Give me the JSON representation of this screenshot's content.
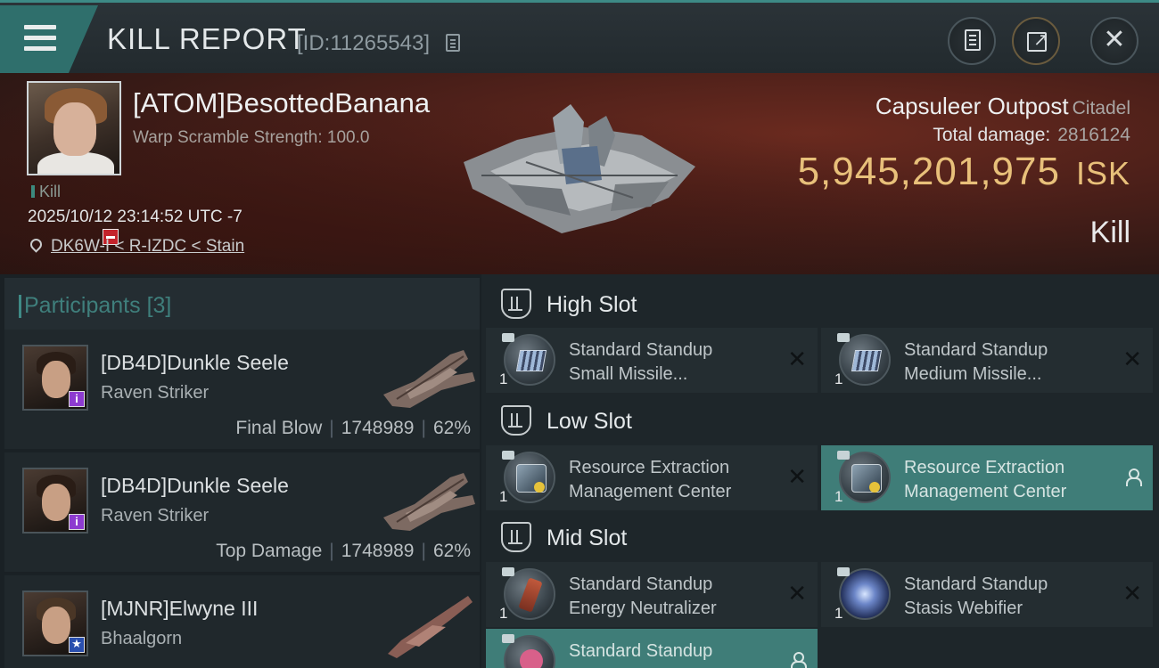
{
  "header": {
    "title": "KILL REPORT",
    "report_id": "[ID:11265543]",
    "icons": {
      "menu": "hamburger-menu-icon",
      "copy": "copy-icon",
      "notes": "clipboard-icon",
      "share": "share-icon",
      "close": "close-icon"
    },
    "accent_color": "#2f6f6c"
  },
  "victim": {
    "name": "[ATOM]BesottedBanana",
    "warp_scramble": "Warp Scramble Strength: 100.0",
    "kill_tag": "Kill",
    "datetime": "2025/10/12 23:14:52 UTC -7",
    "location": "DK6W-I < R-IZDC < Stain",
    "target_name": "Capsuleer Outpost",
    "target_type": "Citadel",
    "total_damage_label": "Total damage:",
    "total_damage_value": "2816124",
    "isk_value": "5,945,201,975",
    "isk_unit": "ISK",
    "result_label": "Kill",
    "isk_color": "#e8c07a"
  },
  "participants": {
    "title": "Participants",
    "count": "[3]",
    "rows": [
      {
        "name": "[DB4D]Dunkle Seele",
        "ship": "Raven Striker",
        "role": "Final Blow",
        "damage": "1748989",
        "percent": "62%",
        "badge": "purple-info-badge"
      },
      {
        "name": "[DB4D]Dunkle Seele",
        "ship": "Raven Striker",
        "role": "Top Damage",
        "damage": "1748989",
        "percent": "62%",
        "badge": "purple-info-badge"
      },
      {
        "name": "[MJNR]Elwyne III",
        "ship": "Bhaalgorn",
        "badge": "blue-star-badge"
      }
    ]
  },
  "slots": {
    "high": {
      "label": "High Slot",
      "modules": [
        {
          "line1": "Standard Standup",
          "line2": "Small Missile...",
          "qty": "1",
          "state": "destroyed"
        },
        {
          "line1": "Standard Standup",
          "line2": "Medium Missile...",
          "qty": "1",
          "state": "destroyed"
        }
      ]
    },
    "low": {
      "label": "Low Slot",
      "modules": [
        {
          "line1": "Resource Extraction",
          "line2": "Management Center",
          "qty": "1",
          "state": "destroyed"
        },
        {
          "line1": "Resource Extraction",
          "line2": "Management Center",
          "qty": "1",
          "state": "dropped"
        }
      ]
    },
    "mid": {
      "label": "Mid Slot",
      "modules": [
        {
          "line1": "Standard Standup",
          "line2": "Energy Neutralizer",
          "qty": "1",
          "state": "destroyed"
        },
        {
          "line1": "Standard Standup",
          "line2": "Stasis Webifier",
          "qty": "1",
          "state": "destroyed"
        },
        {
          "line1": "Standard Standup",
          "line2": "",
          "qty": "",
          "state": "dropped"
        }
      ]
    }
  }
}
